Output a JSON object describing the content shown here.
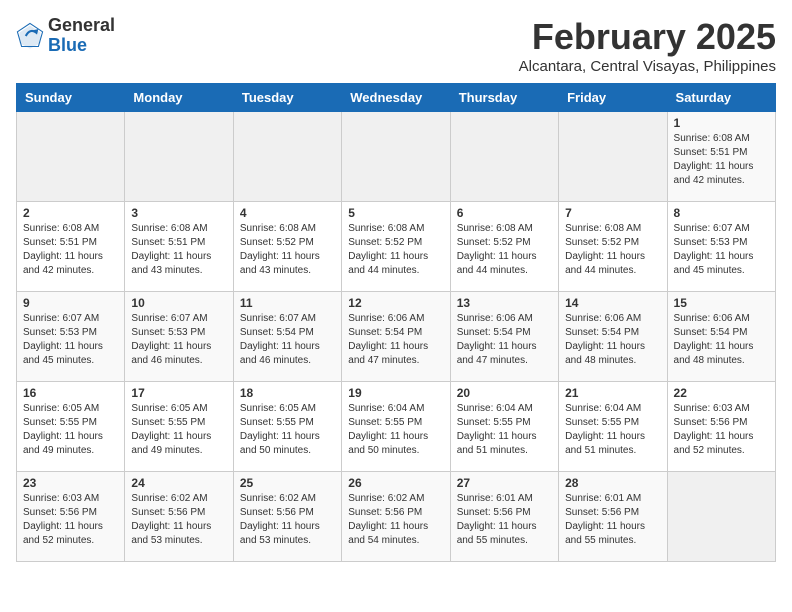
{
  "logo": {
    "general": "General",
    "blue": "Blue"
  },
  "header": {
    "month_year": "February 2025",
    "location": "Alcantara, Central Visayas, Philippines"
  },
  "weekdays": [
    "Sunday",
    "Monday",
    "Tuesday",
    "Wednesday",
    "Thursday",
    "Friday",
    "Saturday"
  ],
  "weeks": [
    [
      {
        "day": "",
        "info": ""
      },
      {
        "day": "",
        "info": ""
      },
      {
        "day": "",
        "info": ""
      },
      {
        "day": "",
        "info": ""
      },
      {
        "day": "",
        "info": ""
      },
      {
        "day": "",
        "info": ""
      },
      {
        "day": "1",
        "info": "Sunrise: 6:08 AM\nSunset: 5:51 PM\nDaylight: 11 hours and 42 minutes."
      }
    ],
    [
      {
        "day": "2",
        "info": "Sunrise: 6:08 AM\nSunset: 5:51 PM\nDaylight: 11 hours and 42 minutes."
      },
      {
        "day": "3",
        "info": "Sunrise: 6:08 AM\nSunset: 5:51 PM\nDaylight: 11 hours and 43 minutes."
      },
      {
        "day": "4",
        "info": "Sunrise: 6:08 AM\nSunset: 5:52 PM\nDaylight: 11 hours and 43 minutes."
      },
      {
        "day": "5",
        "info": "Sunrise: 6:08 AM\nSunset: 5:52 PM\nDaylight: 11 hours and 44 minutes."
      },
      {
        "day": "6",
        "info": "Sunrise: 6:08 AM\nSunset: 5:52 PM\nDaylight: 11 hours and 44 minutes."
      },
      {
        "day": "7",
        "info": "Sunrise: 6:08 AM\nSunset: 5:52 PM\nDaylight: 11 hours and 44 minutes."
      },
      {
        "day": "8",
        "info": "Sunrise: 6:07 AM\nSunset: 5:53 PM\nDaylight: 11 hours and 45 minutes."
      }
    ],
    [
      {
        "day": "9",
        "info": "Sunrise: 6:07 AM\nSunset: 5:53 PM\nDaylight: 11 hours and 45 minutes."
      },
      {
        "day": "10",
        "info": "Sunrise: 6:07 AM\nSunset: 5:53 PM\nDaylight: 11 hours and 46 minutes."
      },
      {
        "day": "11",
        "info": "Sunrise: 6:07 AM\nSunset: 5:54 PM\nDaylight: 11 hours and 46 minutes."
      },
      {
        "day": "12",
        "info": "Sunrise: 6:06 AM\nSunset: 5:54 PM\nDaylight: 11 hours and 47 minutes."
      },
      {
        "day": "13",
        "info": "Sunrise: 6:06 AM\nSunset: 5:54 PM\nDaylight: 11 hours and 47 minutes."
      },
      {
        "day": "14",
        "info": "Sunrise: 6:06 AM\nSunset: 5:54 PM\nDaylight: 11 hours and 48 minutes."
      },
      {
        "day": "15",
        "info": "Sunrise: 6:06 AM\nSunset: 5:54 PM\nDaylight: 11 hours and 48 minutes."
      }
    ],
    [
      {
        "day": "16",
        "info": "Sunrise: 6:05 AM\nSunset: 5:55 PM\nDaylight: 11 hours and 49 minutes."
      },
      {
        "day": "17",
        "info": "Sunrise: 6:05 AM\nSunset: 5:55 PM\nDaylight: 11 hours and 49 minutes."
      },
      {
        "day": "18",
        "info": "Sunrise: 6:05 AM\nSunset: 5:55 PM\nDaylight: 11 hours and 50 minutes."
      },
      {
        "day": "19",
        "info": "Sunrise: 6:04 AM\nSunset: 5:55 PM\nDaylight: 11 hours and 50 minutes."
      },
      {
        "day": "20",
        "info": "Sunrise: 6:04 AM\nSunset: 5:55 PM\nDaylight: 11 hours and 51 minutes."
      },
      {
        "day": "21",
        "info": "Sunrise: 6:04 AM\nSunset: 5:55 PM\nDaylight: 11 hours and 51 minutes."
      },
      {
        "day": "22",
        "info": "Sunrise: 6:03 AM\nSunset: 5:56 PM\nDaylight: 11 hours and 52 minutes."
      }
    ],
    [
      {
        "day": "23",
        "info": "Sunrise: 6:03 AM\nSunset: 5:56 PM\nDaylight: 11 hours and 52 minutes."
      },
      {
        "day": "24",
        "info": "Sunrise: 6:02 AM\nSunset: 5:56 PM\nDaylight: 11 hours and 53 minutes."
      },
      {
        "day": "25",
        "info": "Sunrise: 6:02 AM\nSunset: 5:56 PM\nDaylight: 11 hours and 53 minutes."
      },
      {
        "day": "26",
        "info": "Sunrise: 6:02 AM\nSunset: 5:56 PM\nDaylight: 11 hours and 54 minutes."
      },
      {
        "day": "27",
        "info": "Sunrise: 6:01 AM\nSunset: 5:56 PM\nDaylight: 11 hours and 55 minutes."
      },
      {
        "day": "28",
        "info": "Sunrise: 6:01 AM\nSunset: 5:56 PM\nDaylight: 11 hours and 55 minutes."
      },
      {
        "day": "",
        "info": ""
      }
    ]
  ]
}
